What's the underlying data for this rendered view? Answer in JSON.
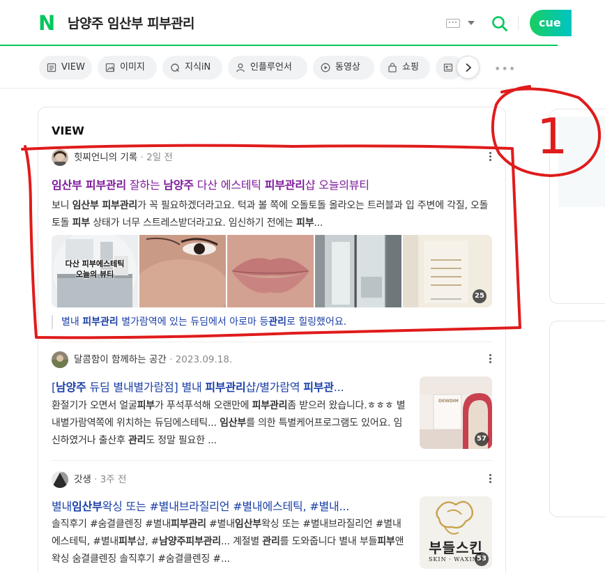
{
  "header": {
    "logo": "N",
    "query": "남양주 임산부 피부관리",
    "pill_text": "cue"
  },
  "tabs": [
    {
      "label": "VIEW",
      "icon": "document-icon"
    },
    {
      "label": "이미지",
      "icon": "image-icon"
    },
    {
      "label": "지식iN",
      "icon": "q-icon"
    },
    {
      "label": "인플루언서",
      "icon": "person-icon"
    },
    {
      "label": "동영상",
      "icon": "play-icon"
    },
    {
      "label": "쇼핑",
      "icon": "bag-icon"
    }
  ],
  "section": {
    "title": "VIEW"
  },
  "results": [
    {
      "author": "힛찌언니의 기록",
      "date": "2일 전",
      "title_parts": [
        {
          "t": "임산부 피부관리",
          "b": true
        },
        {
          "t": " 잘하는 ",
          "b": false
        },
        {
          "t": "남양주",
          "b": true
        },
        {
          "t": " 다산 에스테틱 ",
          "b": false
        },
        {
          "t": "피부관리",
          "b": true
        },
        {
          "t": "샵 오늘의뷰티",
          "b": false
        }
      ],
      "desc_parts": [
        {
          "t": "보니 ",
          "b": false
        },
        {
          "t": "임산부 피부관리",
          "b": true
        },
        {
          "t": "가 꼭 필요하겠더라고요. 턱과 볼 쪽에 오돌토돌 올라오는 트러블과 입 주변에 각질, 오돌토돌 ",
          "b": false
        },
        {
          "t": "피부",
          "b": true
        },
        {
          "t": " 상태가 너무 스트레스받더라고요. 임신하기 전에는 ",
          "b": false
        },
        {
          "t": "피부",
          "b": true
        },
        {
          "t": "...",
          "b": false
        }
      ],
      "thumb1_text": "다산 피부에스테틱\n오늘의 뷰티",
      "image_count": "25",
      "quote_parts": [
        {
          "t": "별내 ",
          "b": false
        },
        {
          "t": "피부관리",
          "b": true
        },
        {
          "t": " 별가람역에 있는 듀딤에서 아로마 등",
          "b": false
        },
        {
          "t": "관리",
          "b": true
        },
        {
          "t": "로 힐링했어요.",
          "b": false
        }
      ]
    },
    {
      "author": "달콤함이 함께하는 공간",
      "date": "2023.09.18.",
      "title_parts": [
        {
          "t": "[",
          "b": false
        },
        {
          "t": "남양주",
          "b": true
        },
        {
          "t": " 듀딤 별내별가람점] 별내 ",
          "b": false
        },
        {
          "t": "피부관리",
          "b": true
        },
        {
          "t": "샵/별가람역 ",
          "b": false
        },
        {
          "t": "피부관",
          "b": true
        },
        {
          "t": "...",
          "b": false
        }
      ],
      "desc_parts": [
        {
          "t": "환절기가 오면서 얼굴",
          "b": false
        },
        {
          "t": "피부",
          "b": true
        },
        {
          "t": "가 푸석푸석해 오랜만에 ",
          "b": false
        },
        {
          "t": "피부관리",
          "b": true
        },
        {
          "t": "좀 받으러 왔습니다.ㅎㅎㅎ 별내별가람역쪽에 위치하는 듀딤에스테틱... ",
          "b": false
        },
        {
          "t": "임산부",
          "b": true
        },
        {
          "t": "를 의한 특별케어프로그램도 있어요. 임신하였거나 출산후 ",
          "b": false
        },
        {
          "t": "관리",
          "b": true
        },
        {
          "t": "도 정말 필요한 ...",
          "b": false
        }
      ],
      "image_count": "57",
      "thumb_sign": "DEWDIM"
    },
    {
      "author": "갓생",
      "date": "3주 전",
      "title_parts": [
        {
          "t": "별내",
          "b": false
        },
        {
          "t": "임산부",
          "b": true
        },
        {
          "t": "왁싱 또는 #별내브라질리언 #별내에스테틱, #별내...",
          "b": false
        }
      ],
      "desc_parts": [
        {
          "t": "솔직후기 #숨결클렌징 #별내",
          "b": false
        },
        {
          "t": "피부관리",
          "b": true
        },
        {
          "t": " #별내",
          "b": false
        },
        {
          "t": "임산부",
          "b": true
        },
        {
          "t": "왁싱 또는 #별내브라질리언 #별내에스테틱, #별내",
          "b": false
        },
        {
          "t": "피부",
          "b": true
        },
        {
          "t": "샵, #",
          "b": false
        },
        {
          "t": "남양주피부관리",
          "b": true
        },
        {
          "t": "... 계절별 ",
          "b": false
        },
        {
          "t": "관리",
          "b": true
        },
        {
          "t": "를 도와줍니다 별내 부들",
          "b": false
        },
        {
          "t": "피부",
          "b": true
        },
        {
          "t": "앤왁싱 숨결클렌징 솔직후기 #숨결클렌징 #...",
          "b": false
        }
      ],
      "image_count": "53",
      "thumb_sign": "부들스킨",
      "thumb_sub": "SKIN · WAXING"
    }
  ],
  "annotation": {
    "label": "1",
    "color": "#e01b1b"
  }
}
